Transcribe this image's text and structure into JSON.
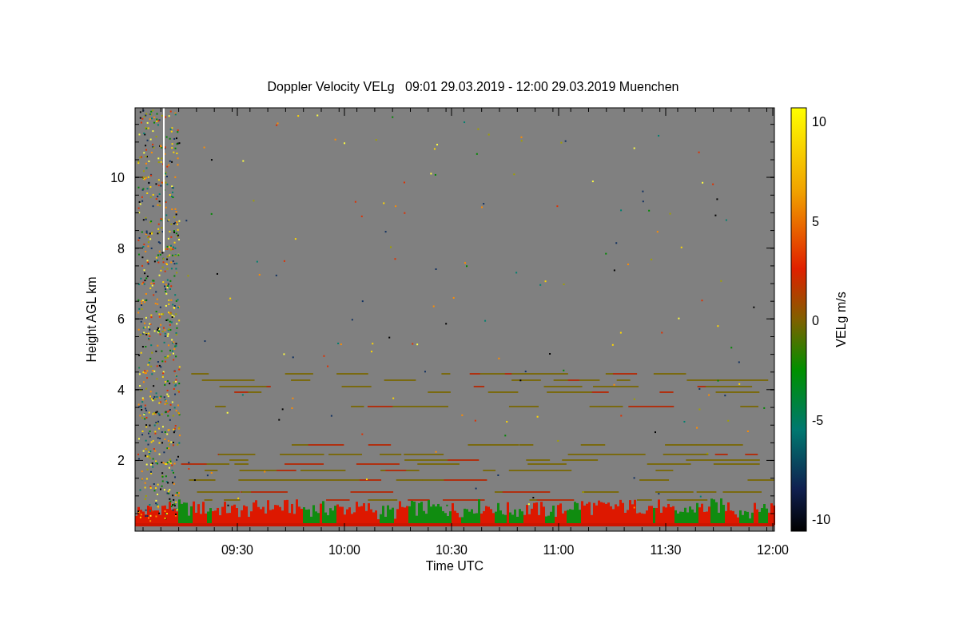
{
  "title": "Doppler Velocity VELg   09:01 29.03.2019 - 12:00 29.03.2019 Muenchen",
  "xlabel": "Time UTC",
  "ylabel": "Height AGL km",
  "xticks": [
    "09:30",
    "10:00",
    "10:30",
    "11:00",
    "11:30",
    "12:00"
  ],
  "yticks": [
    "10",
    "8",
    "6",
    "4",
    "2"
  ],
  "colorbar": {
    "label": "VELg m/s",
    "ticks": [
      "10",
      "5",
      "0",
      "-5",
      "-10"
    ]
  }
}
